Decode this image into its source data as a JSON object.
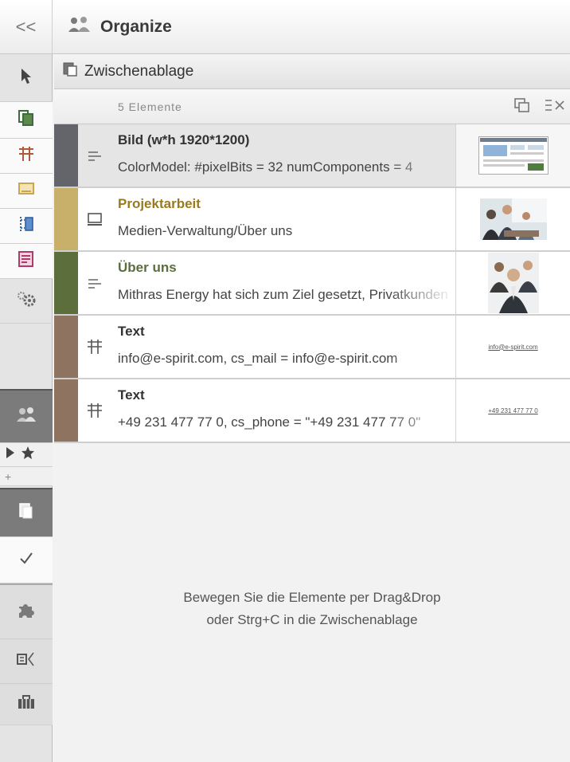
{
  "header": {
    "collapse_label": "<<",
    "title": "Organize",
    "icon": "users-icon"
  },
  "toolbar": {
    "tools": [
      {
        "name": "pointer-icon",
        "state": "normal"
      },
      {
        "name": "pages-icon",
        "state": "active"
      },
      {
        "name": "table-icon",
        "state": "active"
      },
      {
        "name": "media-icon",
        "state": "active"
      },
      {
        "name": "structure-icon",
        "state": "active"
      },
      {
        "name": "content-list-icon",
        "state": "active"
      },
      {
        "name": "settings-icon",
        "state": "normal"
      },
      {
        "name": "users-icon",
        "state": "dark"
      },
      {
        "name": "play-icon",
        "state": "normal"
      },
      {
        "name": "star-icon",
        "state": "normal"
      },
      {
        "name": "add-icon",
        "state": "normal"
      },
      {
        "name": "clipboard-icon",
        "state": "dark"
      },
      {
        "name": "check-icon",
        "state": "active"
      },
      {
        "name": "puzzle-icon",
        "state": "light"
      },
      {
        "name": "dependencies-icon",
        "state": "light"
      },
      {
        "name": "briefcase-icon",
        "state": "light"
      }
    ],
    "add_label": "+"
  },
  "clipboard": {
    "title": "Zwischenablage",
    "icon": "clipboard-icon",
    "count_label": "5 Elemente",
    "items": [
      {
        "title": "Bild (w*h 1920*1200)",
        "description": "ColorModel: #pixelBits = 32 numComponents = 4",
        "type_icon": "text-lines-icon",
        "color": "#63656b",
        "title_color": "#333333",
        "thumbnail": "website-screenshot"
      },
      {
        "title": "Projektarbeit",
        "description": "Medien-Verwaltung/Über uns",
        "type_icon": "media-icon",
        "color": "#c9b06a",
        "title_color": "#9a7a1e",
        "thumbnail": "meeting-photo"
      },
      {
        "title": "Über uns",
        "description": "Mithras Energy hat sich zum Ziel gesetzt, Privatkunden",
        "type_icon": "text-lines-icon",
        "color": "#5b6e3c",
        "title_color": "#5b6e3c",
        "thumbnail": "team-photo"
      },
      {
        "title": "Text",
        "description": "info@e-spirit.com, cs_mail = info@e-spirit.com",
        "type_icon": "table-icon",
        "color": "#8e7360",
        "title_color": "#333333",
        "thumbnail_text": "info@e-spirit.com"
      },
      {
        "title": "Text",
        "description": "+49 231 477 77 0, cs_phone = \"+49 231 477 77 0\"",
        "type_icon": "table-icon",
        "color": "#8e7360",
        "title_color": "#333333",
        "thumbnail_text": "+49 231 477 77 0"
      }
    ],
    "hint_line1": "Bewegen Sie die Elemente per Drag&Drop",
    "hint_line2": "oder Strg+C in die Zwischenablage"
  }
}
